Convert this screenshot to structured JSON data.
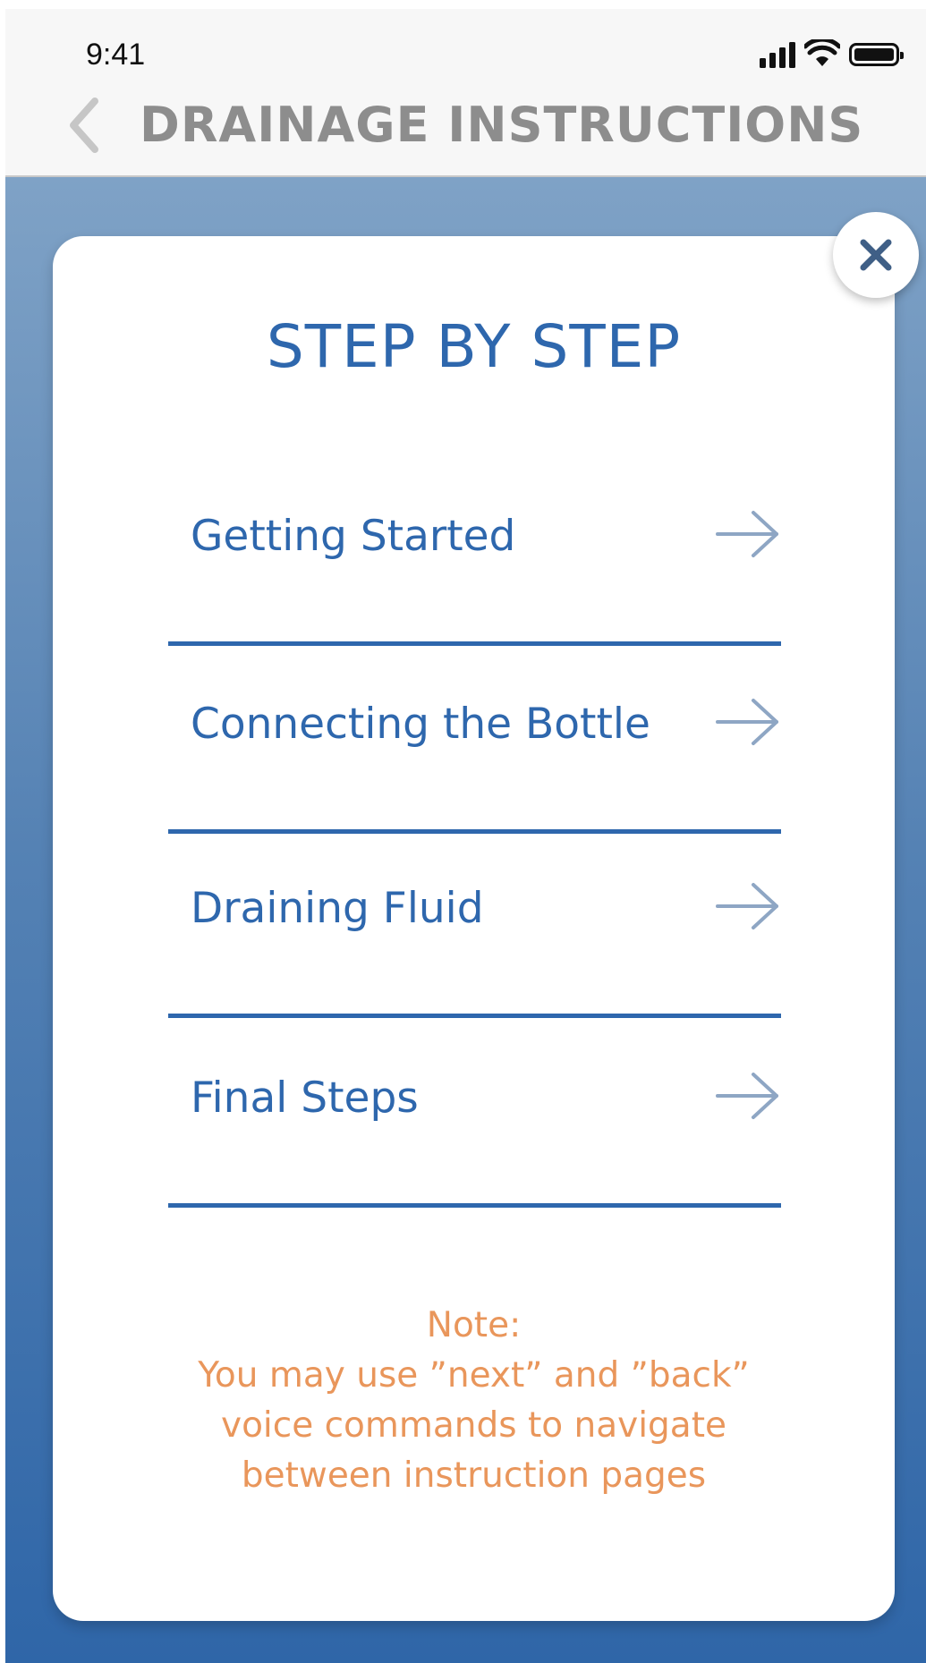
{
  "status_bar": {
    "time": "9:41",
    "icons": [
      "cellular-signal-icon",
      "wifi-icon",
      "battery-icon"
    ]
  },
  "nav": {
    "back_icon": "chevron-left-icon",
    "title": "DRAINAGE INSTRUCTIONS"
  },
  "modal": {
    "close_icon": "close-icon",
    "title": "STEP BY STEP",
    "steps": [
      {
        "label": "Getting Started",
        "icon": "arrow-right-icon"
      },
      {
        "label": "Connecting the Bottle",
        "icon": "arrow-right-icon"
      },
      {
        "label": "Draining Fluid",
        "icon": "arrow-right-icon"
      },
      {
        "label": "Final Steps",
        "icon": "arrow-right-icon"
      }
    ],
    "note": {
      "heading": "Note:",
      "line1": "You may use ”next” and ”back”",
      "line2": "voice commands to navigate",
      "line3": "between instruction pages"
    }
  },
  "colors": {
    "accent_blue": "#2e67ad",
    "note_orange": "#e9965b",
    "nav_gray": "#8d8d8d"
  }
}
